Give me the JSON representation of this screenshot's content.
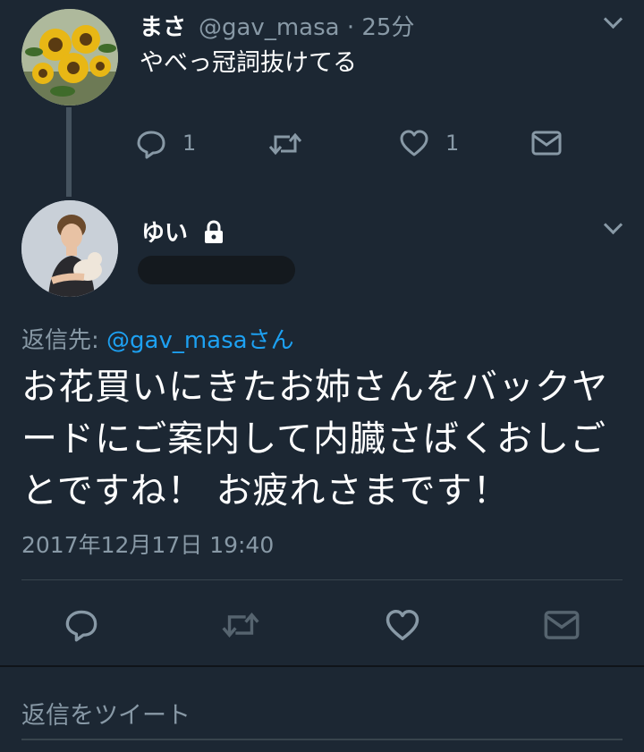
{
  "tweet1": {
    "display_name": "まさ",
    "handle_time": "@gav_masa · 25分",
    "text": "やべっ冠詞抜けてる",
    "reply_count": "1",
    "like_count": "1"
  },
  "tweet2": {
    "display_name": "ゆい",
    "reply_prefix": "返信先: ",
    "reply_mention": "@gav_masa",
    "reply_suffix": "さん",
    "text": "お花買いにきたお姉さんをバックヤードにご案内して内臓さばくおしごとですね！ お疲れさまです！",
    "date": "2017年12月17日 19:40"
  },
  "reply_box": {
    "placeholder": "返信をツイート"
  },
  "colors": {
    "background": "#1c2733",
    "secondary_text": "#8899a6",
    "link": "#1da1f2",
    "divider": "#38444d"
  }
}
